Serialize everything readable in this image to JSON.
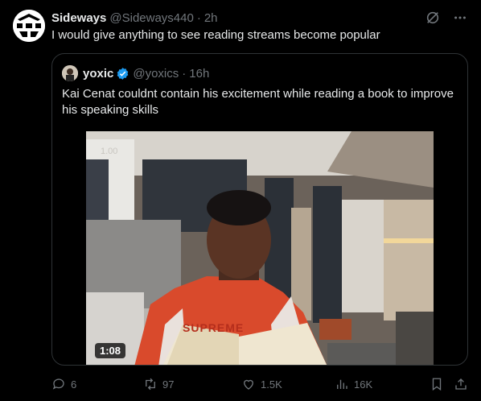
{
  "post": {
    "author_name": "Sideways",
    "author_handle": "@Sideways440",
    "separator": "·",
    "time": "2h",
    "text": "I would give anything to see reading streams become popular"
  },
  "quoted": {
    "author_name": "yoxic",
    "author_handle": "@yoxics",
    "separator": "·",
    "time": "16h",
    "text": "Kai Cenat couldnt contain his excitement while reading a book to improve his speaking skills",
    "video": {
      "duration": "1:08",
      "overlay_text": "1.00",
      "shirt_text": "SUPREME"
    }
  },
  "actions": {
    "replies": "6",
    "reposts": "97",
    "likes": "1.5K",
    "views": "16K"
  },
  "icons": {
    "grok": "grok-icon",
    "more": "more-icon",
    "verified": "verified-badge-icon",
    "reply": "reply-icon",
    "repost": "repost-icon",
    "like": "like-icon",
    "views": "views-icon",
    "bookmark": "bookmark-icon",
    "share": "share-icon"
  },
  "colors": {
    "background": "#000000",
    "text": "#e7e9ea",
    "muted": "#71767b",
    "border": "#2f3336",
    "verified": "#1d9bf0"
  }
}
